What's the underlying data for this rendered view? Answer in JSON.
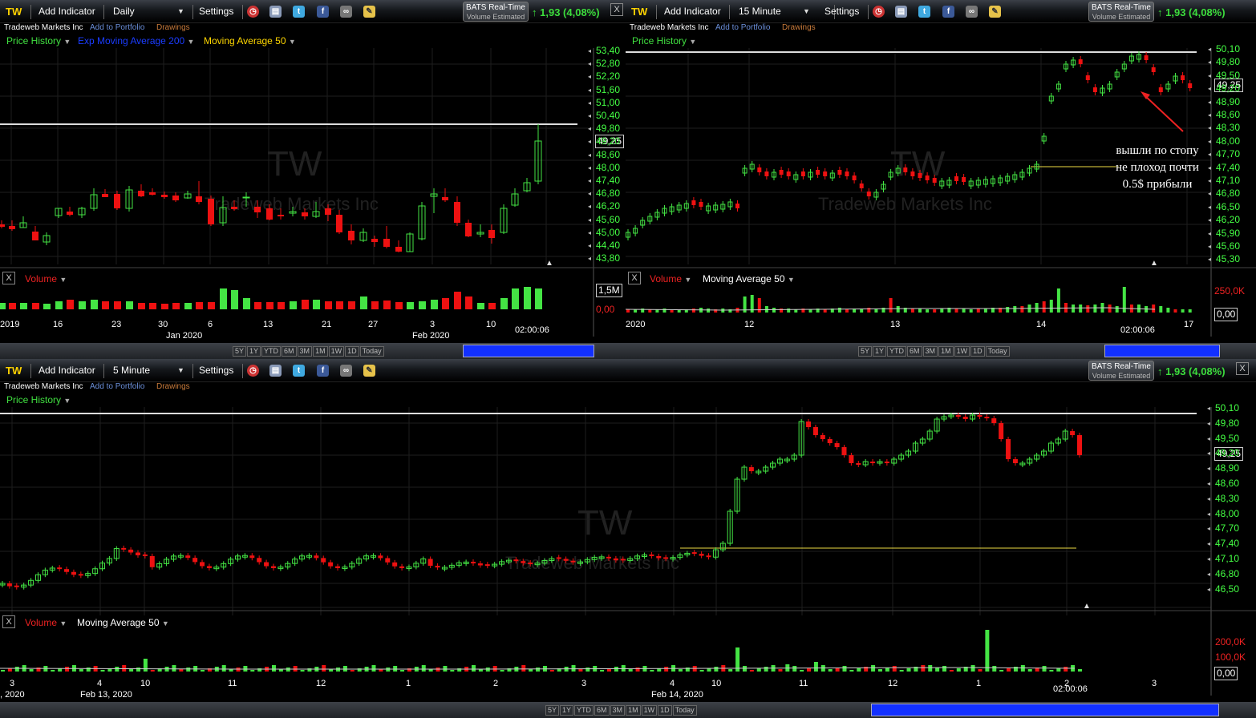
{
  "toolbar_common": {
    "symbol": "TW",
    "add_indicator": "Add Indicator",
    "settings": "Settings",
    "realtime_line1": "BATS Real-Time",
    "realtime_line2": "Volume Estimated",
    "change": "1,93 (4,08%)",
    "company": "Tradeweb Markets Inc",
    "add_portfolio": "Add to Portfolio",
    "drawings": "Drawings",
    "close_symbol": "X",
    "price_history": "Price History",
    "volume": "Volume",
    "time_readout": "02:00:06",
    "watermark_symbol": "TW",
    "watermark_name": "Tradeweb Markets Inc",
    "range_buttons": [
      "5Y",
      "1Y",
      "YTD",
      "6M",
      "3M",
      "1M",
      "1W",
      "1D",
      "Today"
    ]
  },
  "colors": {
    "up": "#44e444",
    "down": "#ee1111",
    "price_axis": "#44ff44",
    "ema": "#1a3cff",
    "ma50": "#ffd700",
    "price_history": "#40e040",
    "volume_label": "#ee2222"
  },
  "icons": [
    "alarm-clock-icon",
    "layers-icon",
    "twitter-icon",
    "facebook-icon",
    "binoculars-icon",
    "notes-icon"
  ],
  "panel_daily": {
    "interval": "Daily",
    "indicators": [
      "Price History",
      "Exp Moving Average 200",
      "Moving Average 50"
    ],
    "price_ticks": [
      "53,40",
      "52,80",
      "52,20",
      "51,60",
      "51,00",
      "50,40",
      "49,80",
      "49,20",
      "48,60",
      "48,00",
      "47,40",
      "46,80",
      "46,20",
      "45,60",
      "45,00",
      "44,40",
      "43,80"
    ],
    "current_price": "49,25",
    "volume_ticks": [
      "1,5M",
      "0,00"
    ],
    "x_labels": [
      "2019",
      "16",
      "23",
      "30",
      "6",
      "13",
      "21",
      "27",
      "3",
      "10"
    ],
    "x_labels_month": [
      "Jan 2020",
      "Feb 2020"
    ]
  },
  "panel_15m": {
    "interval": "15 Minute",
    "indicators": [
      "Price History"
    ],
    "price_ticks": [
      "50,10",
      "49,80",
      "49,50",
      "49,20",
      "48,90",
      "48,60",
      "48,30",
      "48,00",
      "47,70",
      "47,40",
      "47,10",
      "46,80",
      "46,50",
      "46,20",
      "45,90",
      "45,60",
      "45,30"
    ],
    "current_price": "49,25",
    "volume_ma": "Moving Average 50",
    "volume_ticks": [
      "250,0K",
      "0,00"
    ],
    "x_labels": [
      "2020",
      "12",
      "13",
      "14",
      "17"
    ],
    "annotation": [
      "вышли по стопу",
      "не плоход почти",
      "0.5$ прибыли"
    ]
  },
  "panel_5m": {
    "interval": "5 Minute",
    "indicators": [
      "Price History"
    ],
    "price_ticks": [
      "50,10",
      "49,80",
      "49,50",
      "49,20",
      "48,90",
      "48,60",
      "48,30",
      "48,00",
      "47,70",
      "47,40",
      "47,10",
      "46,80",
      "46,50"
    ],
    "current_price": "49,25",
    "volume_ma": "Moving Average 50",
    "volume_ticks": [
      "200,0K",
      "100,0K",
      "0,00"
    ],
    "x_labels": [
      "3",
      "4",
      "10",
      "11",
      "12",
      "1",
      "2",
      "3",
      "4",
      "10",
      "11",
      "12",
      "1",
      "2",
      "3"
    ],
    "x_labels_date": [
      ", 2020",
      "Feb 13, 2020",
      "Feb 14, 2020"
    ]
  }
}
